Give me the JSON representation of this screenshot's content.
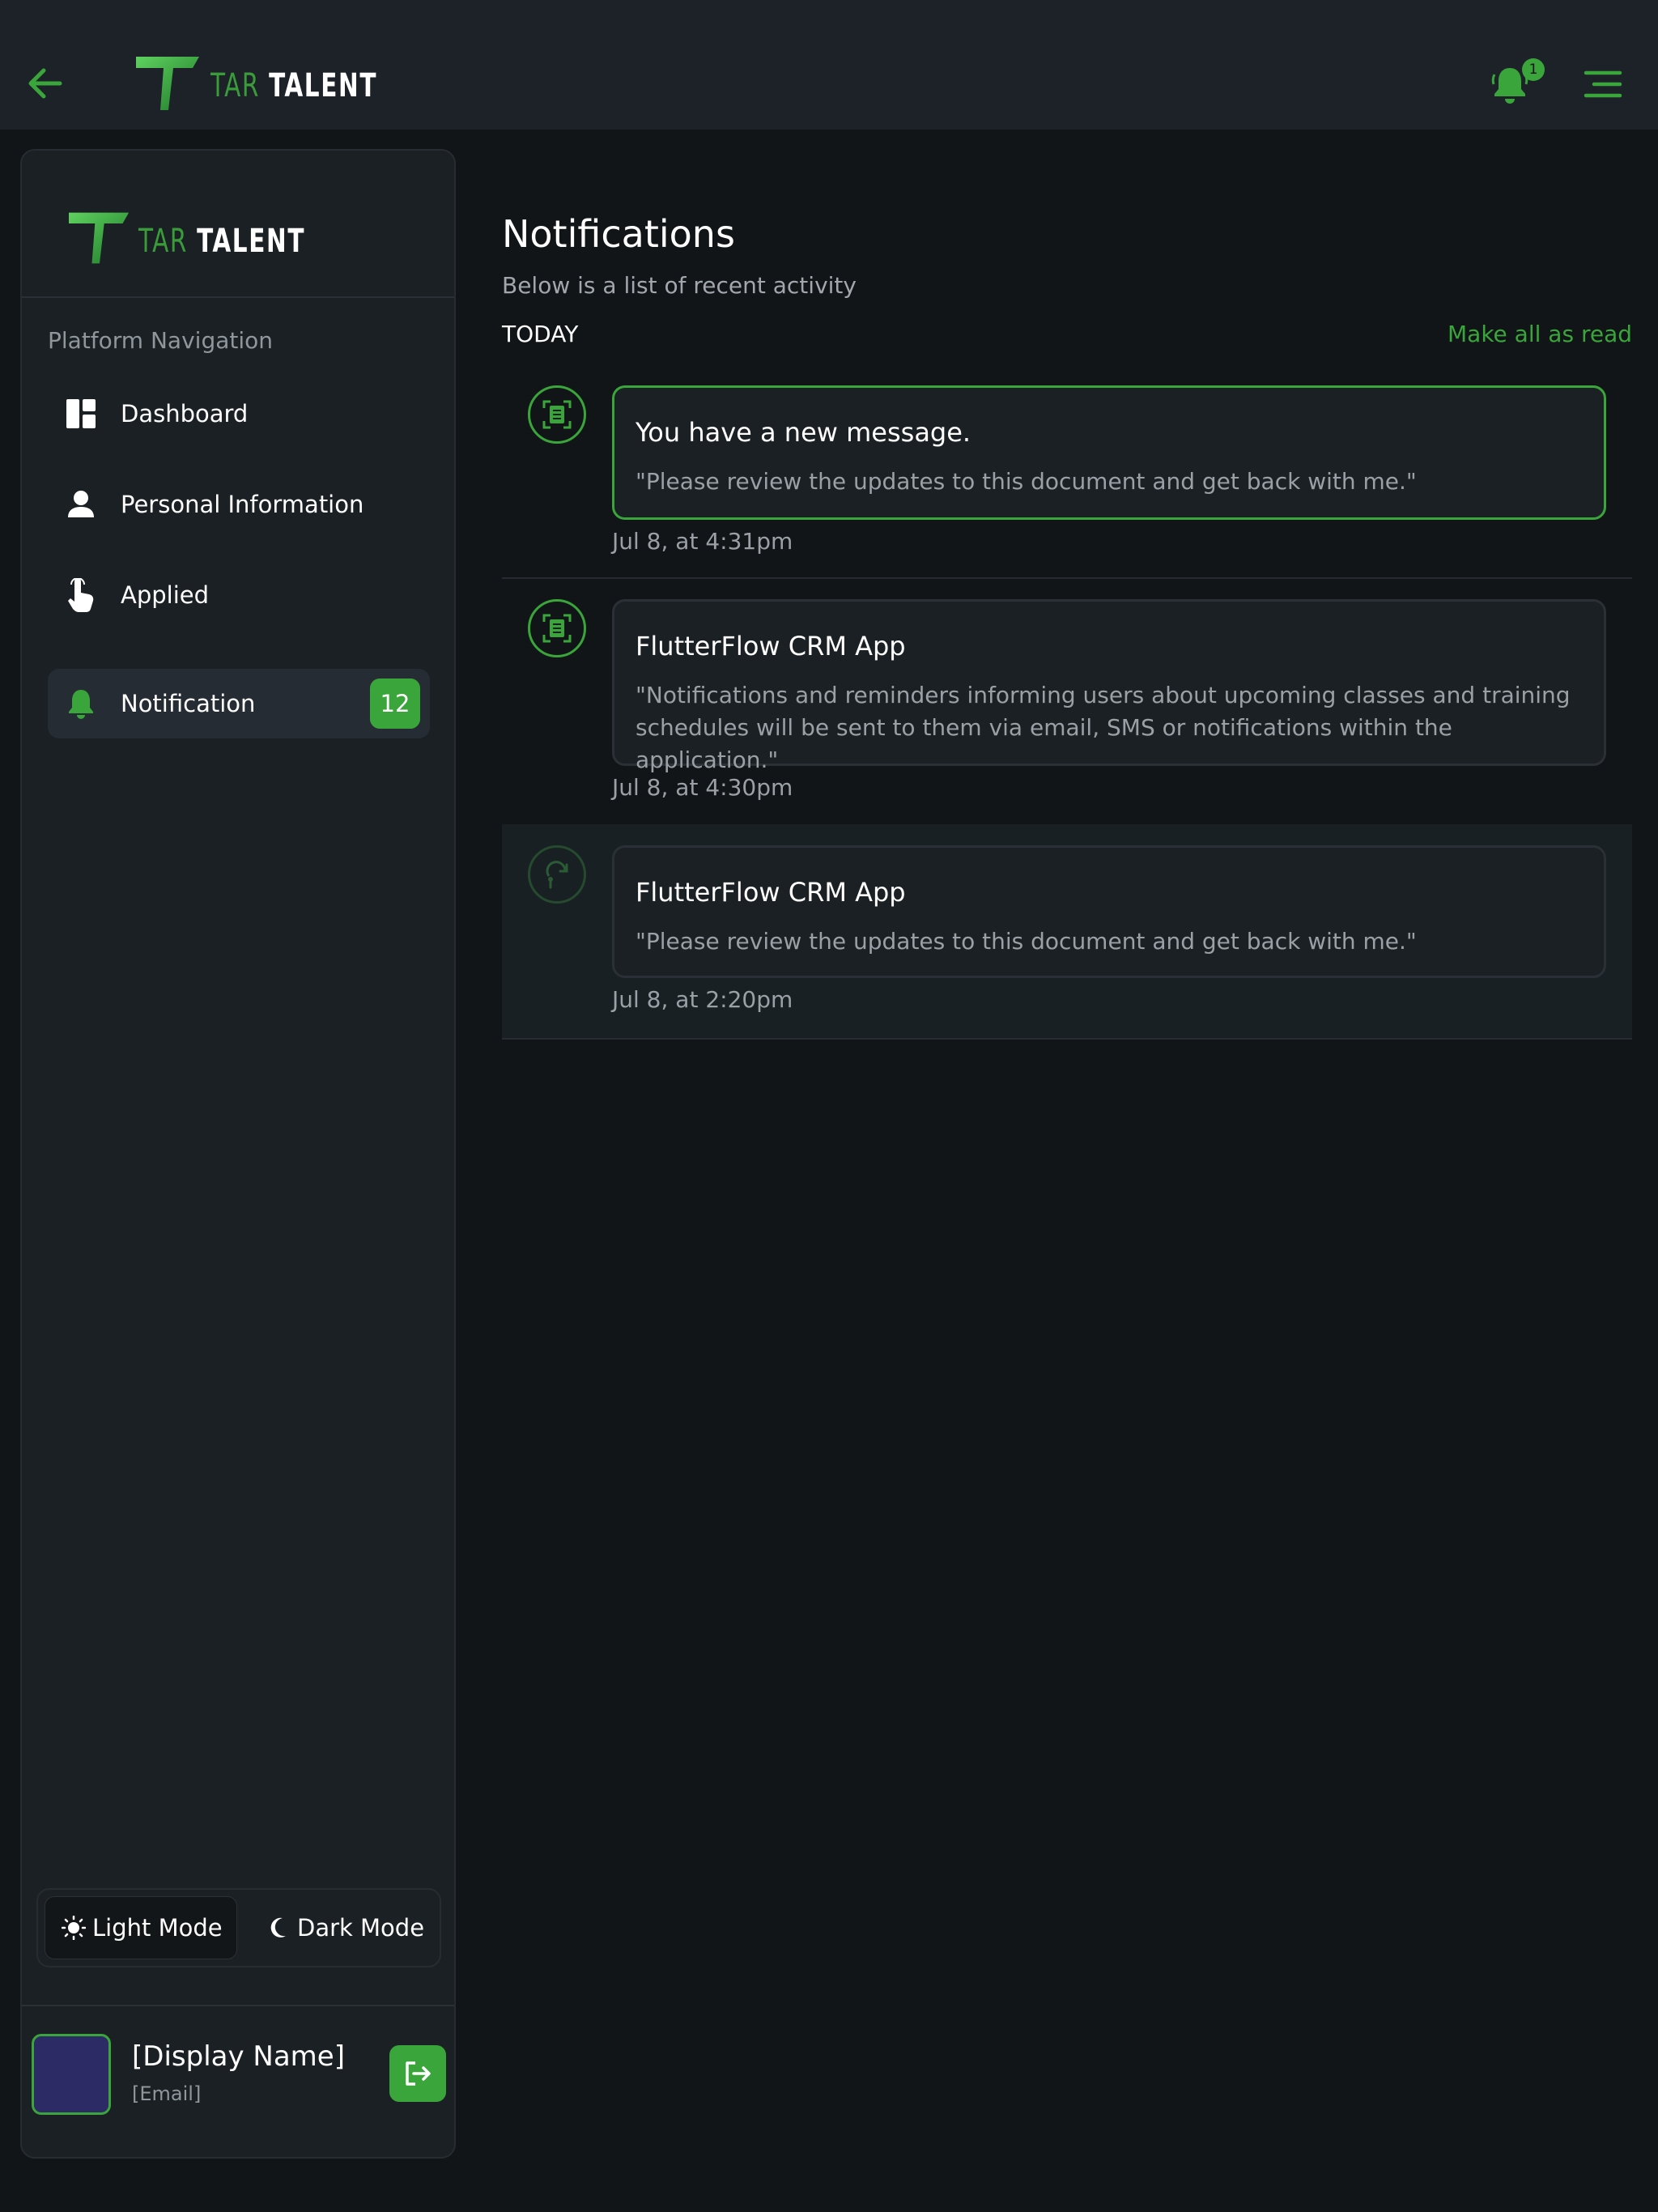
{
  "header": {
    "logo": {
      "tar": "TAR",
      "talent": "TALENT"
    },
    "notification_badge": "1"
  },
  "sidebar": {
    "logo": {
      "tar": "TAR",
      "talent": "TALENT"
    },
    "heading": "Platform Navigation",
    "items": [
      {
        "label": "Dashboard",
        "icon": "dashboard-icon"
      },
      {
        "label": "Personal Information",
        "icon": "person-icon"
      },
      {
        "label": "Applied",
        "icon": "pointer-hand-icon"
      },
      {
        "label": "Notification",
        "icon": "bell-icon",
        "count": "12",
        "active": true
      }
    ],
    "mode": {
      "light_label": "Light Mode",
      "dark_label": "Dark Mode",
      "selected": "light"
    },
    "user": {
      "display_name": "[Display Name]",
      "email": "[Email]"
    }
  },
  "main": {
    "title": "Notifications",
    "subtitle": "Below is a list of recent activity",
    "section_label": "TODAY",
    "mark_all_label": "Make all as read",
    "notifications": [
      {
        "title": "You have a new message.",
        "body": "\"Please review the updates to this document and get back with me.\"",
        "time": "Jul 8, at 4:31pm",
        "icon": "document-scan-icon",
        "highlighted": true
      },
      {
        "title": "FlutterFlow CRM App",
        "body": "\"Notifications and reminders informing users about upcoming classes and training schedules will be sent to them via email, SMS or notifications within the application.\"",
        "time": "Jul 8, at 4:30pm",
        "icon": "document-scan-icon",
        "highlighted": false
      },
      {
        "title": "FlutterFlow CRM App",
        "body": "\"Please review the updates to this document and get back with me.\"",
        "time": "Jul 8, at 2:20pm",
        "icon": "tap-forward-icon",
        "highlighted": false
      }
    ]
  },
  "colors": {
    "accent": "#3aa53a",
    "background": "#111518",
    "header_bg": "#1d2128",
    "sidebar_bg": "#1b2024",
    "avatar": "#2c2b66"
  }
}
